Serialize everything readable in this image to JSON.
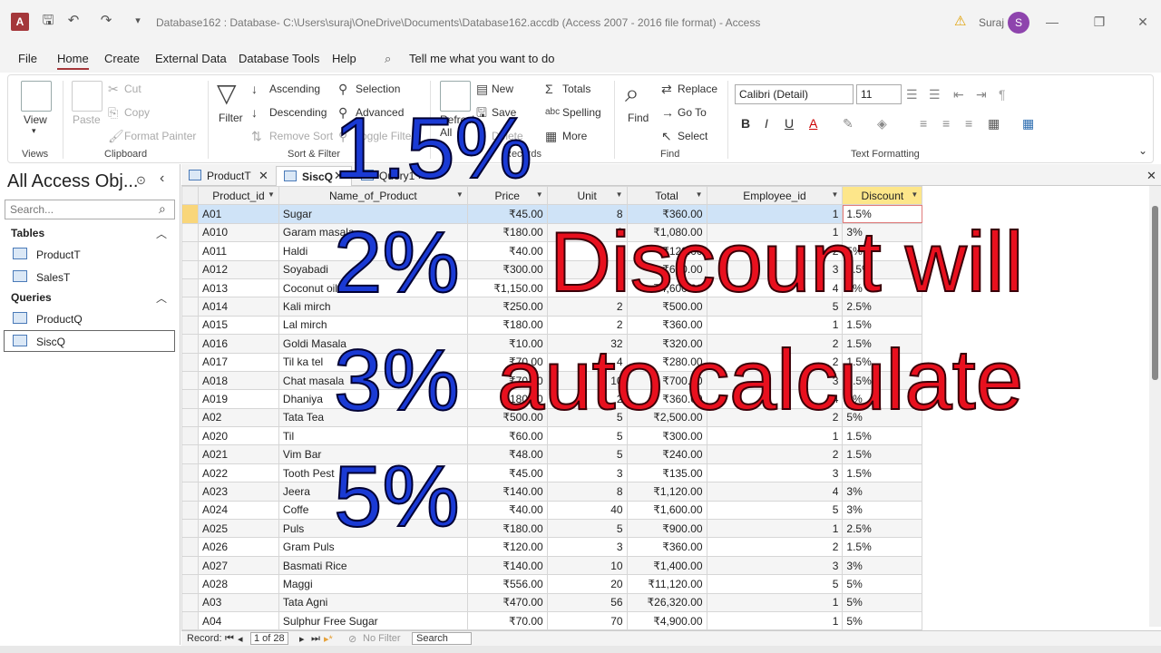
{
  "window": {
    "title": "Database162 : Database- C:\\Users\\suraj\\OneDrive\\Documents\\Database162.accdb (Access 2007 - 2016 file format)  -  Access",
    "app_letter": "A",
    "user": "Suraj",
    "avatar_letter": "S"
  },
  "menu": {
    "items": [
      "File",
      "Home",
      "Create",
      "External Data",
      "Database Tools",
      "Help"
    ],
    "tell_me": "Tell me what you want to do"
  },
  "ribbon": {
    "views": {
      "view": "View",
      "group": "Views"
    },
    "clipboard": {
      "paste": "Paste",
      "cut": "Cut",
      "copy": "Copy",
      "format_painter": "Format Painter",
      "group": "Clipboard"
    },
    "sort_filter": {
      "filter": "Filter",
      "ascending": "Ascending",
      "descending": "Descending",
      "remove_sort": "Remove Sort",
      "selection": "Selection",
      "advanced": "Advanced",
      "toggle_filter": "Toggle Filter",
      "group": "Sort & Filter"
    },
    "records": {
      "refresh": "Refresh",
      "all": "All",
      "new": "New",
      "save": "Save",
      "delete": "Delete",
      "totals": "Totals",
      "spelling": "Spelling",
      "more": "More",
      "group": "Records"
    },
    "find": {
      "find": "Find",
      "replace": "Replace",
      "goto": "Go To",
      "select": "Select",
      "group": "Find"
    },
    "text_formatting": {
      "font": "Calibri (Detail)",
      "size": "11",
      "group": "Text Formatting"
    }
  },
  "nav": {
    "title": "All Access Obj...",
    "search_placeholder": "Search...",
    "tables_label": "Tables",
    "tables": [
      "ProductT",
      "SalesT"
    ],
    "queries_label": "Queries",
    "queries": [
      "ProductQ",
      "SiscQ"
    ]
  },
  "tabs": [
    "ProductT",
    "SiscQ",
    "Query1"
  ],
  "grid": {
    "columns": [
      "Product_id",
      "Name_of_Product",
      "Price",
      "Unit",
      "Total",
      "Employee_id",
      "Discount"
    ],
    "rows": [
      [
        "A01",
        "Sugar",
        "₹45.00",
        "8",
        "₹360.00",
        "1",
        "1.5%"
      ],
      [
        "A010",
        "Garam masala",
        "₹180.00",
        "6",
        "₹1,080.00",
        "1",
        "3%"
      ],
      [
        "A011",
        "Haldi",
        "₹40.00",
        "3",
        "₹120.00",
        "2",
        "5%"
      ],
      [
        "A012",
        "Soyabadi",
        "₹300.00",
        "2",
        "₹600.00",
        "3",
        "1.5%"
      ],
      [
        "A013",
        "Coconut oil",
        "₹1,150.00",
        "4",
        "₹4,600.00",
        "4",
        "3%"
      ],
      [
        "A014",
        "Kali mirch",
        "₹250.00",
        "2",
        "₹500.00",
        "5",
        "2.5%"
      ],
      [
        "A015",
        "Lal mirch",
        "₹180.00",
        "2",
        "₹360.00",
        "1",
        "1.5%"
      ],
      [
        "A016",
        "Goldi Masala",
        "₹10.00",
        "32",
        "₹320.00",
        "2",
        "1.5%"
      ],
      [
        "A017",
        "Til ka tel",
        "₹70.00",
        "4",
        "₹280.00",
        "2",
        "1.5%"
      ],
      [
        "A018",
        "Chat masala",
        "₹70.00",
        "10",
        "₹700.00",
        "3",
        "2.5%"
      ],
      [
        "A019",
        "Dhaniya",
        "₹180.00",
        "2",
        "₹360.00",
        "4",
        "3%"
      ],
      [
        "A02",
        "Tata Tea",
        "₹500.00",
        "5",
        "₹2,500.00",
        "2",
        "5%"
      ],
      [
        "A020",
        "Til",
        "₹60.00",
        "5",
        "₹300.00",
        "1",
        "1.5%"
      ],
      [
        "A021",
        "Vim Bar",
        "₹48.00",
        "5",
        "₹240.00",
        "2",
        "1.5%"
      ],
      [
        "A022",
        "Tooth Pest",
        "₹45.00",
        "3",
        "₹135.00",
        "3",
        "1.5%"
      ],
      [
        "A023",
        "Jeera",
        "₹140.00",
        "8",
        "₹1,120.00",
        "4",
        "3%"
      ],
      [
        "A024",
        "Coffe",
        "₹40.00",
        "40",
        "₹1,600.00",
        "5",
        "3%"
      ],
      [
        "A025",
        "Puls",
        "₹180.00",
        "5",
        "₹900.00",
        "1",
        "2.5%"
      ],
      [
        "A026",
        "Gram Puls",
        "₹120.00",
        "3",
        "₹360.00",
        "2",
        "1.5%"
      ],
      [
        "A027",
        "Basmati Rice",
        "₹140.00",
        "10",
        "₹1,400.00",
        "3",
        "3%"
      ],
      [
        "A028",
        "Maggi",
        "₹556.00",
        "20",
        "₹11,120.00",
        "5",
        "5%"
      ],
      [
        "A03",
        "Tata Agni",
        "₹470.00",
        "56",
        "₹26,320.00",
        "1",
        "5%"
      ],
      [
        "A04",
        "Sulphur Free Sugar",
        "₹70.00",
        "70",
        "₹4,900.00",
        "1",
        "5%"
      ]
    ]
  },
  "record_nav": {
    "label": "Record:",
    "position": "1 of 28",
    "no_filter": "No Filter",
    "search": "Search"
  },
  "overlay": {
    "values": [
      "1.5%",
      "2%",
      "3%",
      "5%"
    ],
    "caption_line1": "Discount will",
    "caption_line2": "auto calculate",
    "value_color": "#1a3ad4",
    "caption_color": "#e8101e"
  },
  "colors": {
    "accent": "#a4373a",
    "selected_row": "#cfe3f7",
    "header_highlight": "#fde68a"
  }
}
